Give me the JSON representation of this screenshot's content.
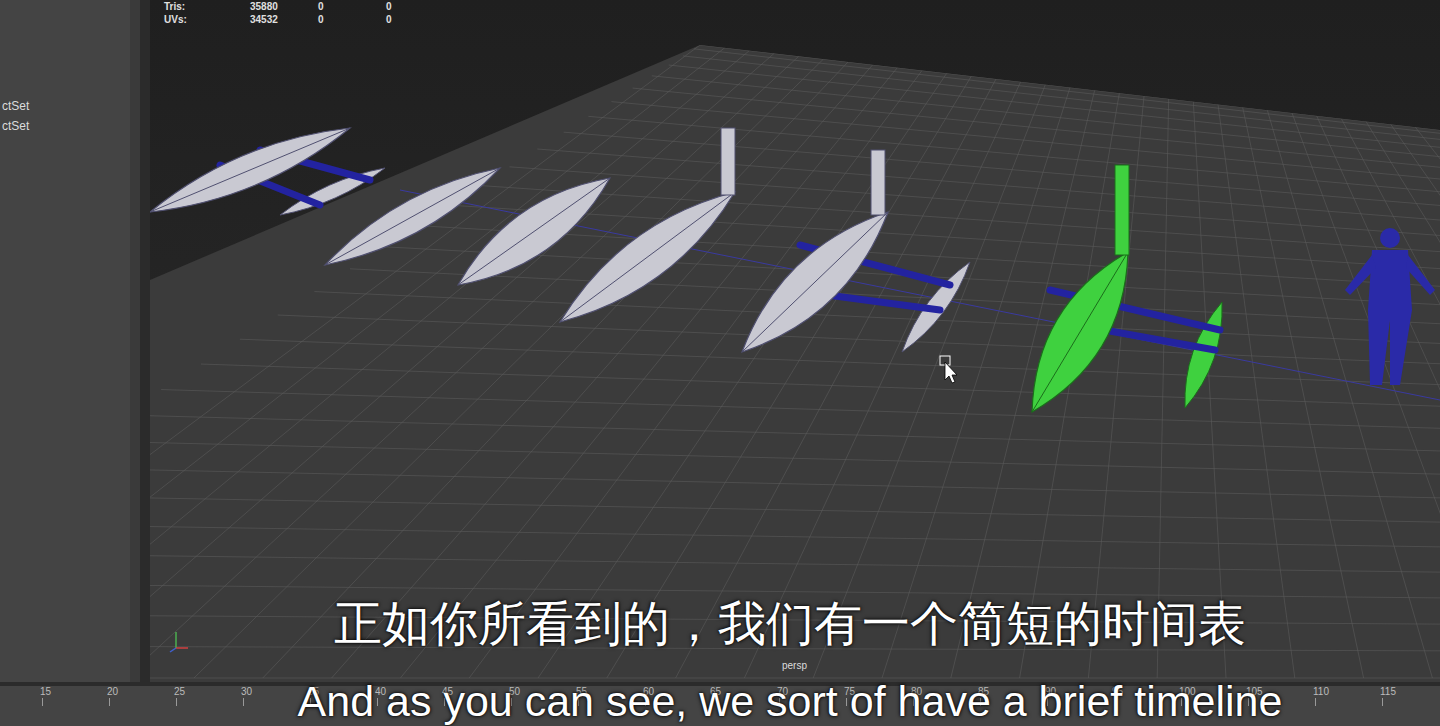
{
  "viewport": {
    "stats": [
      {
        "label": "Tris:",
        "values": [
          "35880",
          "0",
          "0"
        ]
      },
      {
        "label": "UVs:",
        "values": [
          "34532",
          "0",
          "0"
        ]
      }
    ],
    "camera": "persp"
  },
  "outliner": {
    "items": [
      "ctSet",
      "ctSet"
    ]
  },
  "models": [
    {
      "kind": "outrigger-canoe",
      "selected": false
    },
    {
      "kind": "dugout",
      "selected": false
    },
    {
      "kind": "hull",
      "selected": false
    },
    {
      "kind": "masted-hull",
      "selected": false
    },
    {
      "kind": "outrigger-boat",
      "selected": false
    },
    {
      "kind": "outrigger-boat",
      "selected": true
    },
    {
      "kind": "figure",
      "selected": false
    }
  ],
  "timeline": {
    "ticks": [
      "15",
      "20",
      "25",
      "30",
      "35",
      "40",
      "45",
      "50",
      "55",
      "60",
      "65",
      "70",
      "75",
      "80",
      "85",
      "90",
      "95",
      "100",
      "105",
      "110",
      "115"
    ]
  },
  "subtitles": {
    "chinese": "正如你所看到的，我们有一个简短的时间表",
    "english": "And as you can see, we sort of have a brief timeline"
  }
}
